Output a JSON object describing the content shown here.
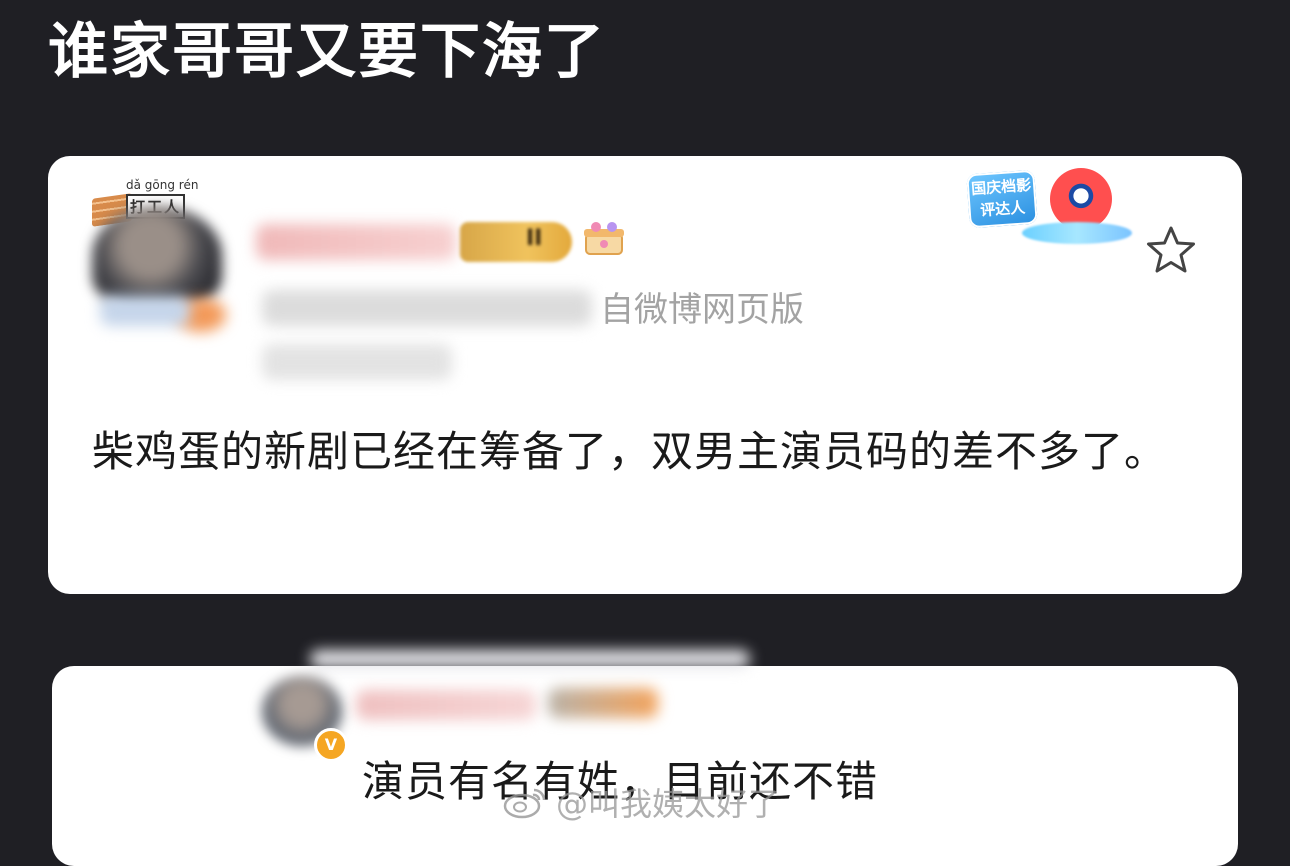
{
  "header": {
    "title": "谁家哥哥又要下海了"
  },
  "post": {
    "user_tag": {
      "pinyin": "dǎ gōng rén",
      "text": "打工人"
    },
    "level_badge": "II",
    "source_suffix": "自微博网页版",
    "festival_badge": "国庆档影评达人",
    "content": "柴鸡蛋的新剧已经在筹备了，双男主演员码的差不多了。"
  },
  "reply": {
    "verified_badge": "V",
    "content": "演员有名有姓，目前还不错"
  },
  "watermark": {
    "text": "@叫我姨太好了"
  },
  "colors": {
    "background": "#1f1f24",
    "card": "#ffffff",
    "text": "#1a1a1a",
    "verified": "#f5a623"
  },
  "icons": [
    "bookmark-star-icon",
    "weibo-icon",
    "gift-icon"
  ]
}
